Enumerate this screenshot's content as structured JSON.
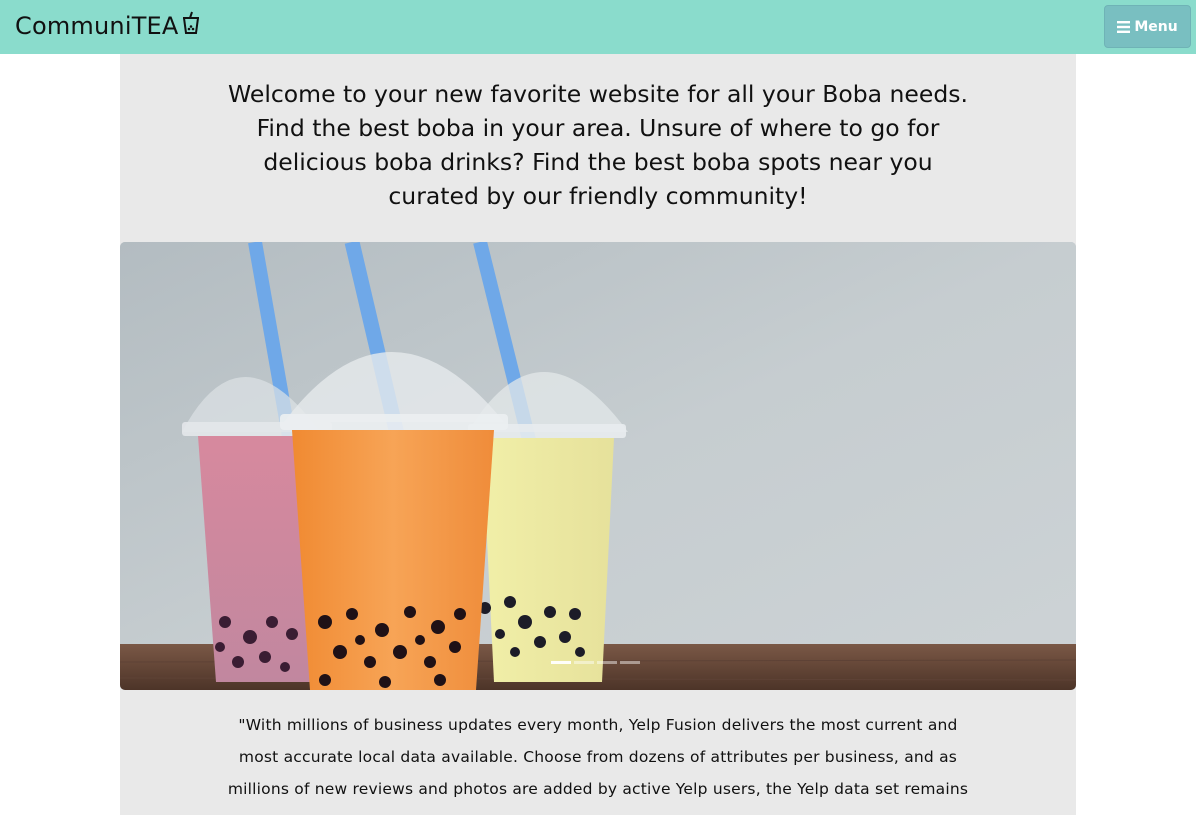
{
  "navbar": {
    "brand": "CommuniTEA",
    "brand_icon": "boba-cup-icon",
    "menu_icon": "hamburger-icon",
    "menu_label": "Menu"
  },
  "intro": {
    "lines": [
      "Welcome to your new favorite website for all your Boba needs.",
      "Find the best boba in your area. Unsure of where to go for",
      "delicious boba drinks? Find the best boba spots near you",
      "curated by our friendly community!"
    ]
  },
  "carousel": {
    "slide_count": 4,
    "active_index": 0,
    "image": "boba-drinks-photo"
  },
  "quote": {
    "lines": [
      "\"With millions of business updates every month, Yelp Fusion delivers the most current and",
      "most accurate local data available. Choose from dozens of attributes per business, and as",
      "millions of new reviews and photos are added by active Yelp users, the Yelp data set remains"
    ]
  },
  "colors": {
    "navbar": "#8adccc",
    "menu_button": "#79bfc1",
    "content_background": "#e9e9e9"
  }
}
